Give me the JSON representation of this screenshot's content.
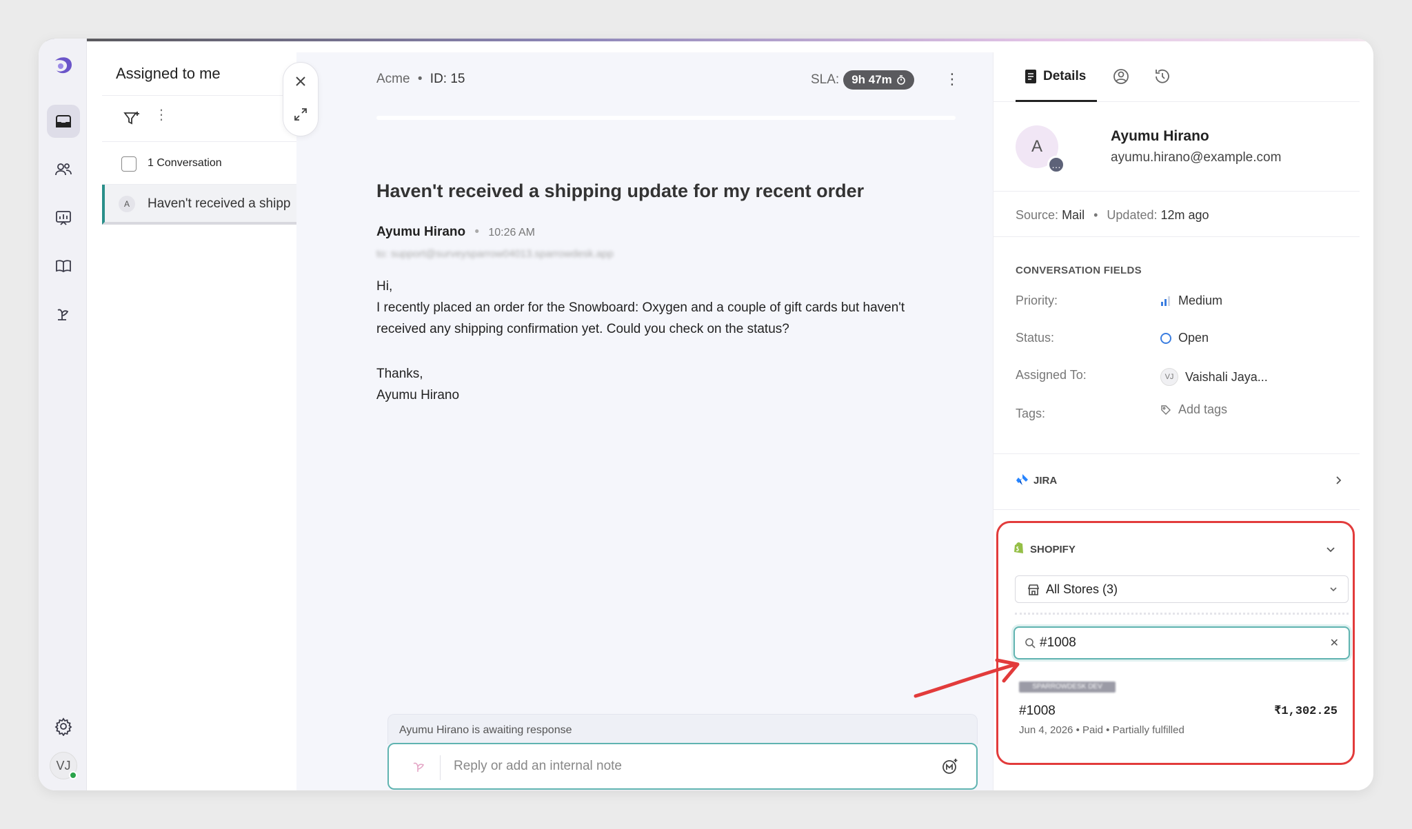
{
  "colors": {
    "accent": "#2a8f8a",
    "highlight_border": "#e23b3b",
    "status_open": "#3a7de0",
    "online": "#2aa34a",
    "brand_logo": "#6b55c9"
  },
  "rail": {
    "items": [
      {
        "name": "inbox-icon",
        "active": true
      },
      {
        "name": "contacts-icon"
      },
      {
        "name": "reports-icon"
      },
      {
        "name": "knowledge-base-icon"
      },
      {
        "name": "ai-agent-icon"
      }
    ],
    "settings_icon": "gear-icon",
    "user_initials": "VJ"
  },
  "list": {
    "title": "Assigned to me",
    "count_label": "1 Conversation",
    "items": [
      {
        "avatar": "A",
        "subject": "Haven't received a shipp"
      }
    ]
  },
  "conversation": {
    "workspace": "Acme",
    "id_label": "ID: 15",
    "sla_label": "SLA:",
    "sla_value": "9h 47m",
    "subject": "Haven't received a shipping update for my recent order",
    "message": {
      "author": "Ayumu Hirano",
      "time": "10:26 AM",
      "to": "to: support@surveysparrow04013.sparrowdesk.app",
      "greeting": "Hi,",
      "body": "I recently placed an order for the Snowboard: Oxygen and a couple of gift cards but haven't received any shipping confirmation yet. Could you check on the status?",
      "signoff": "Thanks,",
      "signature": "Ayumu Hirano"
    },
    "awaiting": "Ayumu Hirano is awaiting response",
    "reply_placeholder": "Reply or add an internal note"
  },
  "details": {
    "tab_label": "Details",
    "contact": {
      "initial": "A",
      "name": "Ayumu Hirano",
      "email": "ayumu.hirano@example.com"
    },
    "source_label": "Source:",
    "source_value": "Mail",
    "updated_label": "Updated:",
    "updated_value": "12m ago",
    "fields_title": "CONVERSATION FIELDS",
    "fields": {
      "priority_label": "Priority:",
      "priority_value": "Medium",
      "status_label": "Status:",
      "status_value": "Open",
      "assigned_label": "Assigned To:",
      "assigned_initials": "VJ",
      "assigned_value": "Vaishali Jaya...",
      "tags_label": "Tags:",
      "tags_value": "Add tags"
    },
    "jira_label": "JIRA",
    "shopify": {
      "label": "SHOPIFY",
      "store_select": "All Stores (3)",
      "search_value": "#1008",
      "store_tag": "SPARROWDESK DEV",
      "order_id": "#1008",
      "order_total": "₹1,302.25",
      "order_meta": "Jun 4, 2026 • Paid • Partially fulfilled"
    }
  }
}
